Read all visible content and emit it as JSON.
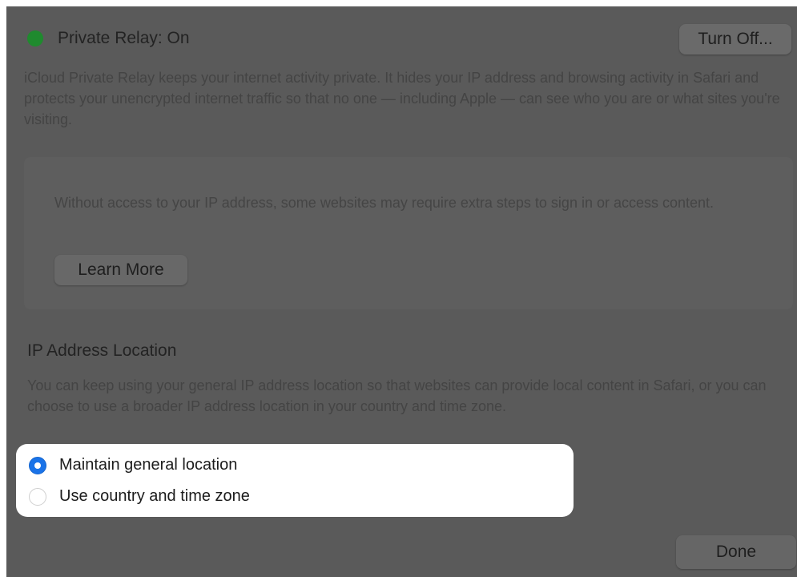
{
  "relay": {
    "status_label": "Private Relay: On",
    "status_color": "#1f8a2e",
    "status_icon": "green-status-dot",
    "turn_off_label": "Turn Off...",
    "description": "iCloud Private Relay keeps your internet activity private. It hides your IP address and browsing activity in Safari and protects your unencrypted internet traffic so that no one — including Apple — can see who you are or what sites you're visiting."
  },
  "notice": {
    "text": "Without access to your IP address, some websites may require extra steps to sign in or access content.",
    "learn_more_label": "Learn More"
  },
  "ip_location": {
    "title": "IP Address Location",
    "description": "You can keep using your general IP address location so that websites can provide local content in Safari, or you can choose to use a broader IP address location in your country and time zone.",
    "options": [
      {
        "label": "Maintain general location",
        "selected": true
      },
      {
        "label": "Use country and time zone",
        "selected": false
      }
    ],
    "selected_color": "#1a73e8"
  },
  "footer": {
    "done_label": "Done"
  }
}
